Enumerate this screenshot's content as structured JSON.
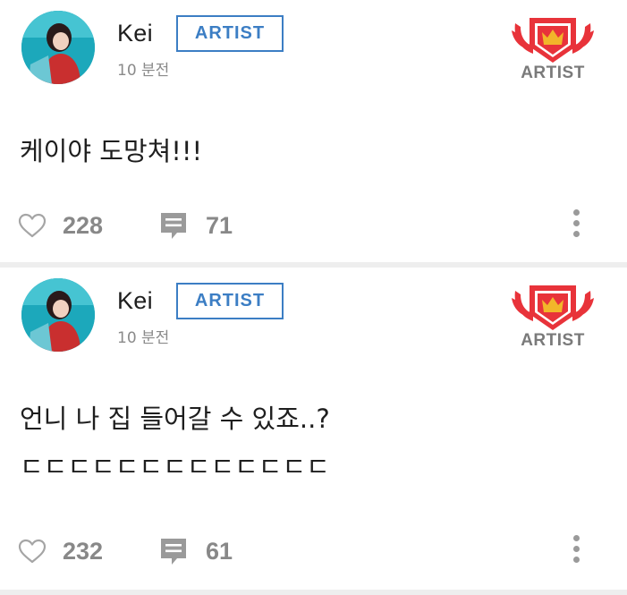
{
  "posts": [
    {
      "author": "Kei",
      "badge": "ARTIST",
      "time": "10 분전",
      "emblem_label": "ARTIST",
      "lines": [
        "케이야 도망쳐!!!"
      ],
      "likes": "228",
      "comments": "71"
    },
    {
      "author": "Kei",
      "badge": "ARTIST",
      "time": "10 분전",
      "emblem_label": "ARTIST",
      "lines": [
        "언니 나 집 들어갈 수 있죠..?",
        "ㄷㄷㄷㄷㄷㄷㄷㄷㄷㄷㄷㄷㄷ"
      ],
      "likes": "232",
      "comments": "61"
    }
  ],
  "icons": {
    "like": "heart-outline-icon",
    "comment": "speech-bubble-icon",
    "more": "more-vertical-icon",
    "emblem": "winged-crown-shield-icon"
  },
  "colors": {
    "badge": "#3c7ec4",
    "emblem": "#e8333a",
    "icon_gray": "#9a9a9a",
    "separator": "#eeeeee"
  }
}
